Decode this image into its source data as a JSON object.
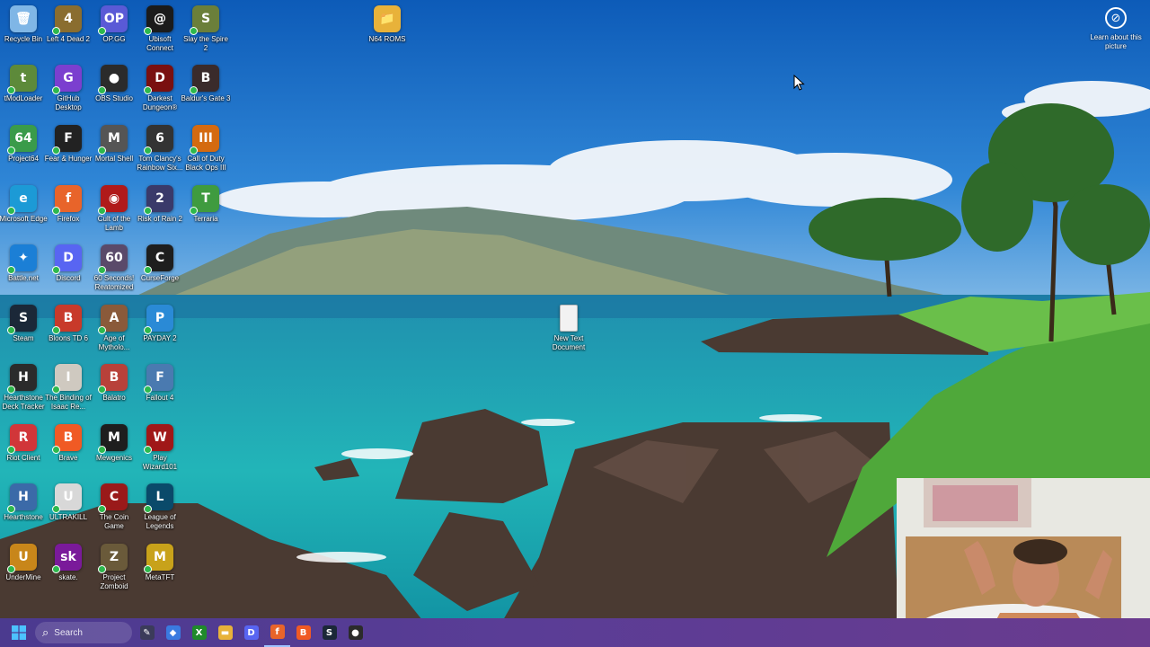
{
  "desktop": {
    "icons": [
      {
        "label": "Recycle Bin",
        "glyph": "🗑",
        "color": "#7fb6e6"
      },
      {
        "label": "Left 4 Dead 2",
        "glyph": "4",
        "color": "#8a6d2f"
      },
      {
        "label": "OP.GG",
        "glyph": "OP",
        "color": "#5a5ad6"
      },
      {
        "label": "Ubisoft Connect",
        "glyph": "@",
        "color": "#1b1b1b"
      },
      {
        "label": "Slay the Spire 2",
        "glyph": "S",
        "color": "#6b7f3a"
      },
      {
        "label": "N64 ROMS",
        "glyph": "📁",
        "color": "#e8b23a"
      },
      {
        "label": "tModLoader",
        "glyph": "t",
        "color": "#5d8a3a"
      },
      {
        "label": "GitHub Desktop",
        "glyph": "G",
        "color": "#7b3fcf"
      },
      {
        "label": "OBS Studio",
        "glyph": "●",
        "color": "#2b2b2b"
      },
      {
        "label": "Darkest Dungeon®",
        "glyph": "D",
        "color": "#7a1010"
      },
      {
        "label": "Baldur's Gate 3",
        "glyph": "B",
        "color": "#3a2b2b"
      },
      {
        "label": "Project64",
        "glyph": "64",
        "color": "#3a9b4a"
      },
      {
        "label": "Fear & Hunger",
        "glyph": "F",
        "color": "#222222"
      },
      {
        "label": "Mortal Shell",
        "glyph": "M",
        "color": "#555555"
      },
      {
        "label": "Tom Clancy's Rainbow Six...",
        "glyph": "6",
        "color": "#333333"
      },
      {
        "label": "Call of Duty Black Ops III",
        "glyph": "III",
        "color": "#d46a10"
      },
      {
        "label": "Microsoft Edge",
        "glyph": "e",
        "color": "#1c9ad6"
      },
      {
        "label": "Firefox",
        "glyph": "f",
        "color": "#e8642a"
      },
      {
        "label": "Cult of the Lamb",
        "glyph": "◉",
        "color": "#b01a1a"
      },
      {
        "label": "Risk of Rain 2",
        "glyph": "2",
        "color": "#3a3a6a"
      },
      {
        "label": "Terraria",
        "glyph": "T",
        "color": "#3f9b3f"
      },
      {
        "label": "Battle.net",
        "glyph": "✦",
        "color": "#1b7fd6"
      },
      {
        "label": "Discord",
        "glyph": "D",
        "color": "#5865f2"
      },
      {
        "label": "60 Seconds! Reatomized",
        "glyph": "60",
        "color": "#5a4a6a"
      },
      {
        "label": "CurseForge",
        "glyph": "C",
        "color": "#1e1e1e"
      },
      {
        "label": "Steam",
        "glyph": "S",
        "color": "#1b2838"
      },
      {
        "label": "Bloons TD 6",
        "glyph": "B",
        "color": "#c83a2a"
      },
      {
        "label": "Age of Mytholo...",
        "glyph": "A",
        "color": "#8a5a3a"
      },
      {
        "label": "PAYDAY 2",
        "glyph": "P",
        "color": "#2a8ad6"
      },
      {
        "label": "Hearthstone Deck Tracker",
        "glyph": "H",
        "color": "#2b2b2b"
      },
      {
        "label": "The Binding of Isaac Re...",
        "glyph": "I",
        "color": "#cfc9c0"
      },
      {
        "label": "Balatro",
        "glyph": "B",
        "color": "#b8413a"
      },
      {
        "label": "Fallout 4",
        "glyph": "F",
        "color": "#4a7ab0"
      },
      {
        "label": "Riot Client",
        "glyph": "R",
        "color": "#d13639"
      },
      {
        "label": "Brave",
        "glyph": "B",
        "color": "#f05a24"
      },
      {
        "label": "Mewgenics",
        "glyph": "M",
        "color": "#1e1e1e"
      },
      {
        "label": "Play Wizard101",
        "glyph": "W",
        "color": "#a01818"
      },
      {
        "label": "Hearthstone",
        "glyph": "H",
        "color": "#3b6aa8"
      },
      {
        "label": "ULTRAKILL",
        "glyph": "U",
        "color": "#d8d8d8"
      },
      {
        "label": "The Coin Game",
        "glyph": "C",
        "color": "#9a1a1a"
      },
      {
        "label": "League of Legends",
        "glyph": "L",
        "color": "#0a4a6a"
      },
      {
        "label": "UnderMine",
        "glyph": "U",
        "color": "#c8861a"
      },
      {
        "label": "skate.",
        "glyph": "sk",
        "color": "#7a1a9a"
      },
      {
        "label": "Project Zomboid",
        "glyph": "Z",
        "color": "#6a5a3a"
      },
      {
        "label": "MetaTFT",
        "glyph": "M",
        "color": "#c8a21a"
      },
      {
        "label": "New Text Document",
        "glyph": "",
        "color": "#f2f2f2"
      }
    ],
    "learn_about": {
      "label": "Learn about this picture",
      "glyph": "⊘"
    }
  },
  "taskbar": {
    "start_icon": "windows-icon",
    "search_placeholder": "Search",
    "search_glyph": "⌕",
    "pinned": [
      {
        "name": "widgets",
        "glyph": "✎",
        "color": "#3b3b5a"
      },
      {
        "name": "copilot",
        "glyph": "◆",
        "color": "#3a7ae0"
      },
      {
        "name": "xbox",
        "glyph": "X",
        "color": "#1f8a2a"
      },
      {
        "name": "file-explorer",
        "glyph": "▬",
        "color": "#e8b23a"
      },
      {
        "name": "discord",
        "glyph": "D",
        "color": "#5865f2"
      },
      {
        "name": "firefox",
        "glyph": "f",
        "color": "#e8642a"
      },
      {
        "name": "brave",
        "glyph": "B",
        "color": "#f05a24"
      },
      {
        "name": "steam",
        "glyph": "S",
        "color": "#1b2838"
      },
      {
        "name": "obs",
        "glyph": "●",
        "color": "#2b2b2b"
      }
    ]
  }
}
